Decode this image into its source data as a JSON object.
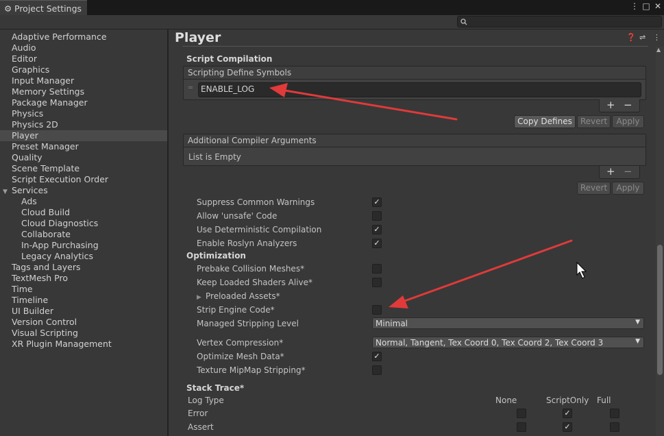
{
  "window": {
    "tab_title": "Project Settings",
    "search_placeholder": ""
  },
  "sidebar": {
    "items": [
      {
        "label": "Adaptive Performance"
      },
      {
        "label": "Audio"
      },
      {
        "label": "Editor"
      },
      {
        "label": "Graphics"
      },
      {
        "label": "Input Manager"
      },
      {
        "label": "Memory Settings"
      },
      {
        "label": "Package Manager"
      },
      {
        "label": "Physics"
      },
      {
        "label": "Physics 2D"
      },
      {
        "label": "Player"
      },
      {
        "label": "Preset Manager"
      },
      {
        "label": "Quality"
      },
      {
        "label": "Scene Template"
      },
      {
        "label": "Script Execution Order"
      },
      {
        "label": "Services"
      },
      {
        "label": "Ads"
      },
      {
        "label": "Cloud Build"
      },
      {
        "label": "Cloud Diagnostics"
      },
      {
        "label": "Collaborate"
      },
      {
        "label": "In-App Purchasing"
      },
      {
        "label": "Legacy Analytics"
      },
      {
        "label": "Tags and Layers"
      },
      {
        "label": "TextMesh Pro"
      },
      {
        "label": "Time"
      },
      {
        "label": "Timeline"
      },
      {
        "label": "UI Builder"
      },
      {
        "label": "Version Control"
      },
      {
        "label": "Visual Scripting"
      },
      {
        "label": "XR Plugin Management"
      }
    ],
    "selected": "Player"
  },
  "main": {
    "title": "Player",
    "script_compilation": {
      "header": "Script Compilation",
      "define_symbols_header": "Scripting Define Symbols",
      "define_symbols": [
        "ENABLE_LOG"
      ],
      "copy_defines": "Copy Defines",
      "revert": "Revert",
      "apply": "Apply",
      "plus": "+",
      "minus": "−"
    },
    "compiler_args": {
      "header": "Additional Compiler Arguments",
      "empty": "List is Empty",
      "revert": "Revert",
      "apply": "Apply",
      "plus": "+",
      "minus": "−"
    },
    "toggles": [
      {
        "label": "Suppress Common Warnings",
        "checked": true
      },
      {
        "label": "Allow 'unsafe' Code",
        "checked": false
      },
      {
        "label": "Use Deterministic Compilation",
        "checked": true
      },
      {
        "label": "Enable Roslyn Analyzers",
        "checked": true
      }
    ],
    "optimization": {
      "header": "Optimization",
      "prebake": {
        "label": "Prebake Collision Meshes*",
        "checked": false
      },
      "keep_shaders": {
        "label": "Keep Loaded Shaders Alive*",
        "checked": false
      },
      "preloaded": "Preloaded Assets*",
      "strip_engine": {
        "label": "Strip Engine Code*",
        "checked": false
      },
      "stripping_level": {
        "label": "Managed Stripping Level",
        "value": "Minimal"
      },
      "vertex_compression": {
        "label": "Vertex Compression*",
        "value": "Normal, Tangent, Tex Coord 0, Tex Coord 2, Tex Coord 3"
      },
      "optimize_mesh": {
        "label": "Optimize Mesh Data*",
        "checked": true
      },
      "texture_mip": {
        "label": "Texture MipMap Stripping*",
        "checked": false
      }
    },
    "stack_trace": {
      "header": "Stack Trace*",
      "col_log_type": "Log Type",
      "col_none": "None",
      "col_script": "ScriptOnly",
      "col_full": "Full",
      "rows": [
        {
          "label": "Error",
          "none": false,
          "script": true,
          "full": false
        },
        {
          "label": "Assert",
          "none": false,
          "script": true,
          "full": false
        }
      ]
    }
  },
  "colors": {
    "annotation_arrow": "#e03a3a",
    "accent_selected": "#4a4a4a"
  }
}
